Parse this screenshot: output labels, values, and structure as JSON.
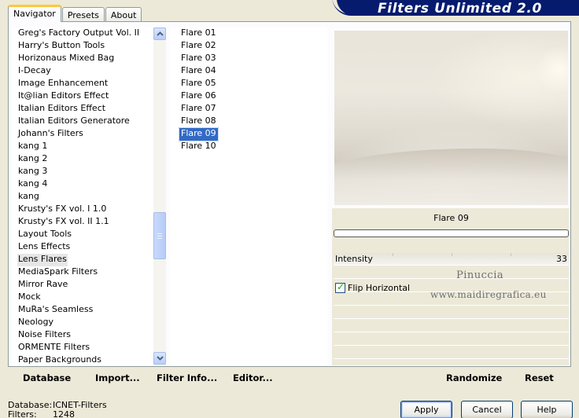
{
  "banner_title": "Filters Unlimited 2.0",
  "tabs": [
    {
      "label": "Navigator",
      "active": true
    },
    {
      "label": "Presets",
      "active": false
    },
    {
      "label": "About",
      "active": false
    }
  ],
  "categories": [
    "Greg's Factory Output Vol. II",
    "Harry's Button Tools",
    "Horizonaus Mixed Bag",
    "I-Decay",
    "Image Enhancement",
    "It@lian Editors Effect",
    "Italian Editors Effect",
    "Italian Editors Generatore",
    "Johann's Filters",
    "kang 1",
    "kang 2",
    "kang 3",
    "kang 4",
    "kang",
    "Krusty's FX vol. I 1.0",
    "Krusty's FX vol. II 1.1",
    "Layout Tools",
    "Lens Effects",
    "Lens Flares",
    "MediaSpark Filters",
    "Mirror Rave",
    "Mock",
    "MuRa's Seamless",
    "Neology",
    "Noise Filters",
    "ORMENTE Filters",
    "Paper Backgrounds"
  ],
  "selected_category": "Lens Flares",
  "filters": [
    "Flare 01",
    "Flare 02",
    "Flare 03",
    "Flare 04",
    "Flare 05",
    "Flare 06",
    "Flare 07",
    "Flare 08",
    "Flare 09",
    "Flare 10"
  ],
  "selected_filter": "Flare 09",
  "filter_name_display": "Flare 09",
  "progress": 0,
  "slider": {
    "label": "Intensity",
    "value": "33"
  },
  "checkbox": {
    "label": "Flip Horizontal",
    "checked": true
  },
  "watermark": {
    "line1": "Pinuccia",
    "line2": "www.maidiregrafica.eu"
  },
  "actions": {
    "database": "Database",
    "import": "Import...",
    "filter_info": "Filter Info...",
    "editor": "Editor...",
    "randomize": "Randomize",
    "reset": "Reset"
  },
  "status": {
    "database_label": "Database:",
    "database_value": "ICNET-Filters",
    "filters_label": "Filters:",
    "filters_value": "1248"
  },
  "buttons": {
    "apply": "Apply",
    "cancel": "Cancel",
    "help": "Help"
  },
  "colors": {
    "banner": "#061b6e",
    "selection": "#316ac5",
    "tab_highlight": "#ffc73c"
  }
}
